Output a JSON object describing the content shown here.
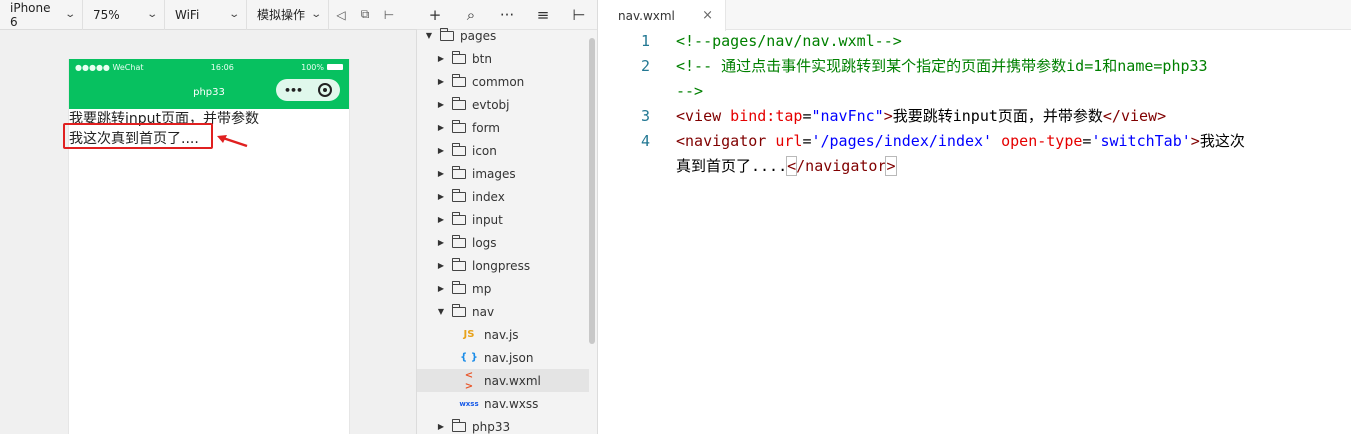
{
  "simulator": {
    "device": "iPhone 6",
    "zoom": "75%",
    "network": "WiFi",
    "simulate_ops": "模拟操作",
    "status_bar": {
      "signal": "●●●●● WeChat",
      "time": "16:06",
      "battery": "100%"
    },
    "nav_title": "php33",
    "capsule_dots": "•••",
    "page_lines": [
      "我要跳转input页面，并带参数",
      "我这次真到首页了...."
    ]
  },
  "tree": {
    "toolbar": [
      "+",
      "⌕",
      "···",
      "≡",
      "⊢"
    ],
    "items": [
      {
        "label": "pages",
        "kind": "folder",
        "open": true,
        "depth": 0
      },
      {
        "label": "btn",
        "kind": "folder",
        "open": false,
        "depth": 1
      },
      {
        "label": "common",
        "kind": "folder",
        "open": false,
        "depth": 1
      },
      {
        "label": "evtobj",
        "kind": "folder",
        "open": false,
        "depth": 1
      },
      {
        "label": "form",
        "kind": "folder",
        "open": false,
        "depth": 1
      },
      {
        "label": "icon",
        "kind": "folder",
        "open": false,
        "depth": 1
      },
      {
        "label": "images",
        "kind": "folder",
        "open": false,
        "depth": 1
      },
      {
        "label": "index",
        "kind": "folder",
        "open": false,
        "depth": 1
      },
      {
        "label": "input",
        "kind": "folder",
        "open": false,
        "depth": 1
      },
      {
        "label": "logs",
        "kind": "folder",
        "open": false,
        "depth": 1
      },
      {
        "label": "longpress",
        "kind": "folder",
        "open": false,
        "depth": 1
      },
      {
        "label": "mp",
        "kind": "folder",
        "open": false,
        "depth": 1
      },
      {
        "label": "nav",
        "kind": "folder",
        "open": true,
        "depth": 1
      },
      {
        "label": "nav.js",
        "kind": "file",
        "icon": "JS",
        "icon_color": "#e8a21a",
        "depth": 2
      },
      {
        "label": "nav.json",
        "kind": "file",
        "icon": "{ }",
        "icon_color": "#1a8ce8",
        "depth": 2
      },
      {
        "label": "nav.wxml",
        "kind": "file",
        "icon": "< >",
        "icon_color": "#e8562a",
        "depth": 2,
        "selected": true
      },
      {
        "label": "nav.wxss",
        "kind": "file",
        "icon": "wxss",
        "icon_color": "#1a5ce8",
        "depth": 2
      },
      {
        "label": "php33",
        "kind": "folder",
        "open": false,
        "depth": 1
      }
    ]
  },
  "editor": {
    "tab_label": "nav.wxml",
    "tab_close": "×",
    "line_numbers": [
      "1",
      "2",
      "3",
      "4"
    ],
    "code": {
      "l1": "<!--pages/nav/nav.wxml-->",
      "l2a": "<!-- 通过点击事件实现跳转到某个指定的页面并携带参数id=1和name=php33",
      "l2b": "-->",
      "l3_open": "<view",
      "l3_attr": " bind:tap",
      "l3_eq": "=",
      "l3_val": "\"navFnc\"",
      "l3_gt": ">",
      "l3_text": "我要跳转input页面，并带参数",
      "l3_close": "</view>",
      "l4_open": "<navigator",
      "l4_attr1": " url",
      "l4_eq1": "=",
      "l4_val1": "'/pages/index/index'",
      "l4_attr2": " open-type",
      "l4_eq2": "=",
      "l4_val2": "'switchTab'",
      "l4_gt": ">",
      "l4_text1": "我这次",
      "l4_text2": "真到首页了....",
      "l4_lt": "<",
      "l4_close_tag": "/navigator",
      "l4_close_gt": ">"
    }
  },
  "colors": {
    "wechat_green": "#07c160",
    "annotation_red": "#e02020"
  }
}
